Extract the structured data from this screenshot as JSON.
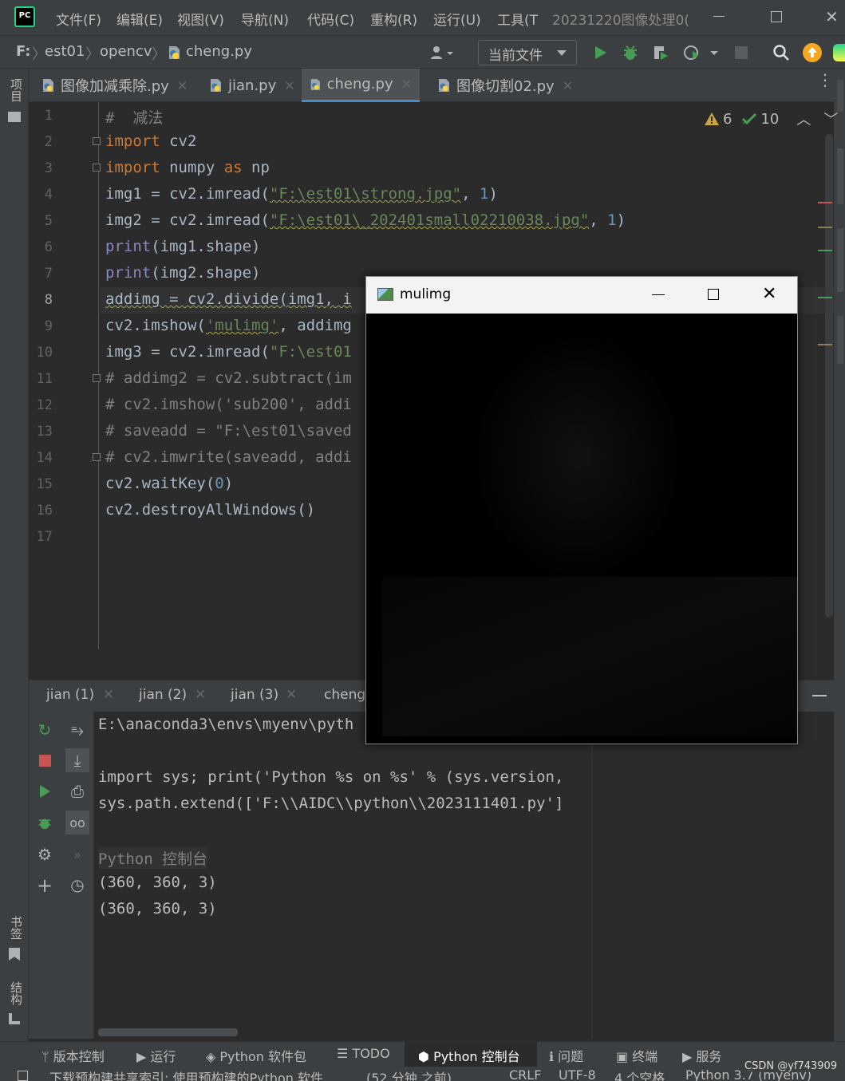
{
  "menubar": {
    "logo": "PC",
    "items": [
      "文件(F)",
      "编辑(E)",
      "视图(V)",
      "导航(N)",
      "代码(C)",
      "重构(R)",
      "运行(U)",
      "工具(T"
    ],
    "project_title": "20231220图像处理0("
  },
  "navbar": {
    "drive": "F:",
    "crumbs": [
      "est01",
      "opencv",
      "cheng.py"
    ],
    "run_config": "当前文件"
  },
  "left_strip": {
    "project": "项目",
    "bookmarks": "书签",
    "structure": "结构"
  },
  "editor_tabs": [
    {
      "label": "图像加减乘除.py",
      "active": false
    },
    {
      "label": "jian.py",
      "active": false
    },
    {
      "label": "cheng.py",
      "active": true
    },
    {
      "label": "图像切割02.py",
      "active": false
    }
  ],
  "inspections": {
    "warnings": "6",
    "ok": "10"
  },
  "line_numbers": [
    "1",
    "2",
    "3",
    "4",
    "5",
    "6",
    "7",
    "8",
    "9",
    "10",
    "11",
    "12",
    "13",
    "14",
    "15",
    "16",
    "17"
  ],
  "code": {
    "l1_comment": "#  减法",
    "import": "import",
    "l2_mod": " cv2",
    "l3_mod": " numpy ",
    "as": "as",
    "l3_alias": " np",
    "l4_a": "img1 = cv2.imread(",
    "l4_str": "\"F:\\est01\\strong.jpg\"",
    "l4_b": ", ",
    "l4_n": "1",
    "l4_c": ")",
    "l5_a": "img2 = cv2.imread(",
    "l5_str": "\"F:\\est01\\_202401small02210038.jpg\"",
    "l5_b": ", ",
    "l5_n": "1",
    "l5_c": ")",
    "print": "print",
    "l6_arg": "(img1.shape)",
    "l7_arg": "(img2.shape)",
    "l8_a": "addimg = cv2.divide(img1, i",
    "l9_a": "cv2.imshow(",
    "l9_str": "'mulimg'",
    "l9_b": ", addimg",
    "l10_a": "img3 = cv2.imread(",
    "l10_str": "\"F:\\est01",
    "l11": "# addimg2 = cv2.subtract(im",
    "l12": "# cv2.imshow('sub200', addi",
    "l13": "# saveadd = \"F:\\est01\\saved",
    "l14": "# cv2.imwrite(saveadd, addi",
    "l15_a": "cv2.waitKey(",
    "l15_n": "0",
    "l15_c": ")",
    "l16": "cv2.destroyAllWindows()"
  },
  "run_tabs": [
    "jian (1)",
    "jian (2)",
    "jian (3)",
    "cheng"
  ],
  "console": {
    "line1": "E:\\anaconda3\\envs\\myenv\\pyth",
    "line2": "import sys; print('Python %s on %s' % (sys.version,",
    "line3": "sys.path.extend(['F:\\\\AIDC\\\\python\\\\2023111401.py']",
    "prompt": "Python 控制台",
    "out1": "(360, 360, 3)",
    "out2": "(360, 360, 3)"
  },
  "tool_windows": [
    "版本控制",
    "运行",
    "Python 软件包",
    "TODO",
    "Python 控制台",
    "问题",
    "终端",
    "服务"
  ],
  "statusbar": {
    "message": "下载预构建共享索引: 使用预构建的Python 软件",
    "time": "(52 分钟 之前)",
    "line_sep": "CRLF",
    "encoding": "UTF-8",
    "indent": "4 个空格",
    "interpreter": "Python 3.7 (myenv)"
  },
  "watermark": "CSDN @yf743909",
  "popup_window": {
    "title": "mulimg"
  },
  "colors": {
    "bg": "#2b2b2b",
    "panel": "#3c3f41",
    "keyword": "#cc7832",
    "string": "#6a8759",
    "number": "#6897bb",
    "comment": "#808080",
    "accent": "#4a88c7",
    "run_green": "#499c54"
  }
}
